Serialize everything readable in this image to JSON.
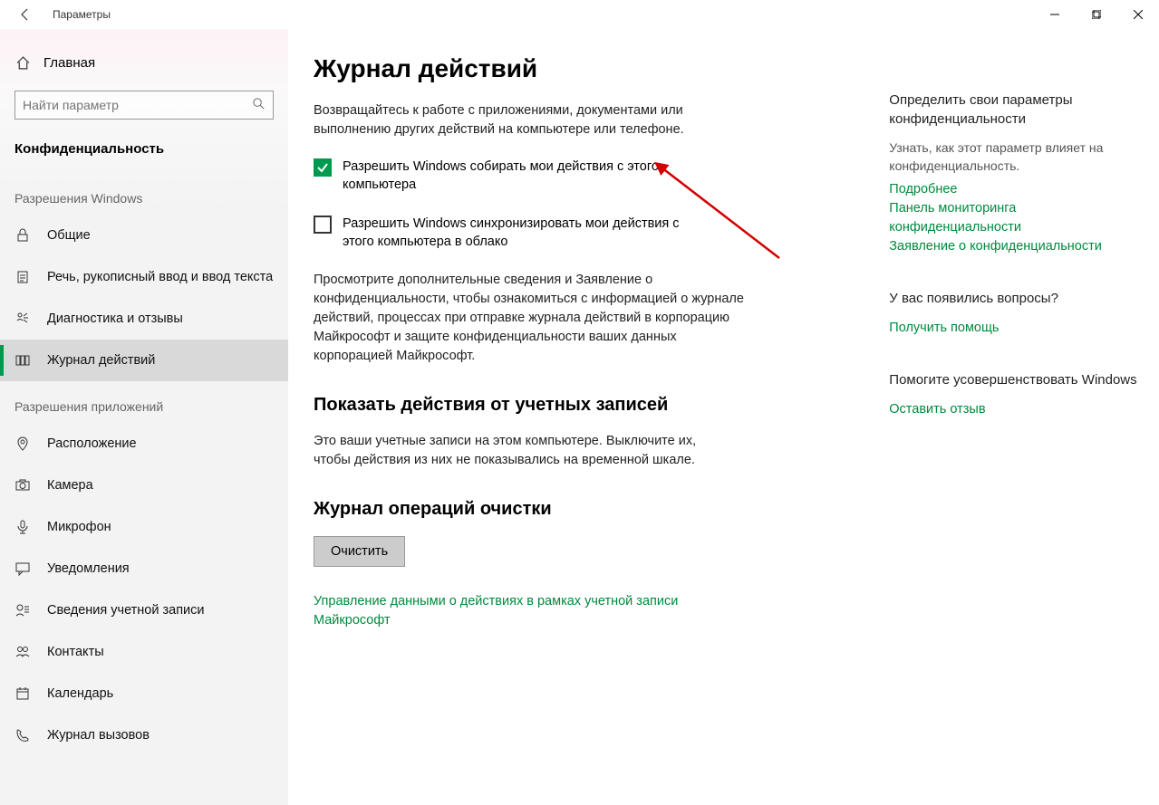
{
  "window": {
    "title": "Параметры"
  },
  "sidebar": {
    "home": "Главная",
    "search_placeholder": "Найти параметр",
    "section": "Конфиденциальность",
    "group_win": "Разрешения Windows",
    "group_app": "Разрешения приложений",
    "items_win": [
      {
        "id": "general",
        "label": "Общие"
      },
      {
        "id": "speech",
        "label": "Речь, рукописный ввод и ввод текста"
      },
      {
        "id": "diag",
        "label": "Диагностика и отзывы"
      },
      {
        "id": "activity",
        "label": "Журнал действий"
      }
    ],
    "items_app": [
      {
        "id": "location",
        "label": "Расположение"
      },
      {
        "id": "camera",
        "label": "Камера"
      },
      {
        "id": "microphone",
        "label": "Микрофон"
      },
      {
        "id": "notifications",
        "label": "Уведомления"
      },
      {
        "id": "account",
        "label": "Сведения учетной записи"
      },
      {
        "id": "contacts",
        "label": "Контакты"
      },
      {
        "id": "calendar",
        "label": "Календарь"
      },
      {
        "id": "calls",
        "label": "Журнал вызовов"
      }
    ]
  },
  "main": {
    "heading": "Журнал действий",
    "intro": "Возвращайтесь к работе с приложениями, документами или выполнению других действий на компьютере или телефоне.",
    "cb1": "Разрешить Windows собирать мои действия с этого компьютера",
    "cb2": "Разрешить Windows синхронизировать мои действия с этого компьютера в облако",
    "detail": "Просмотрите дополнительные сведения и Заявление о конфиденциальности, чтобы ознакомиться с информацией о журнале действий, процессах при отправке журнала действий в корпорацию Майкрософт и защите конфиденциальности ваших данных корпорацией Майкрософт.",
    "accounts_heading": "Показать действия от учетных записей",
    "accounts_body": "Это ваши учетные записи на этом компьютере. Выключите их, чтобы действия из них не показывались на временной шкале.",
    "clear_heading": "Журнал операций очистки",
    "clear_btn": "Очистить",
    "manage_link": "Управление данными о действиях в рамках учетной записи Майкрософт"
  },
  "right": {
    "g1_title": "Определить свои параметры конфиденциальности",
    "g1_sub": "Узнать, как этот параметр влияет на конфиденциальность.",
    "g1_l1": "Подробнее",
    "g1_l2": "Панель мониторинга конфиденциальности",
    "g1_l3": "Заявление о конфиденциальности",
    "g2_title": "У вас появились вопросы?",
    "g2_l1": "Получить помощь",
    "g3_title": "Помогите усовершенствовать Windows",
    "g3_l1": "Оставить отзыв"
  }
}
